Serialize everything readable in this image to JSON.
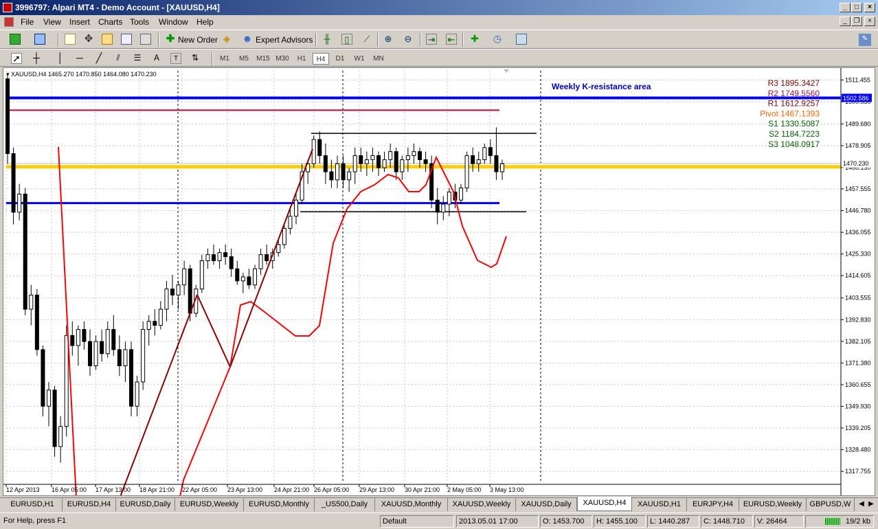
{
  "window": {
    "title": "3996797: Alpari MT4 - Demo Account - [XAUUSD,H4]"
  },
  "menu": [
    "File",
    "View",
    "Insert",
    "Charts",
    "Tools",
    "Window",
    "Help"
  ],
  "toolbar": {
    "new_order": "New Order",
    "expert_advisors": "Expert Advisors"
  },
  "timeframes": [
    "M1",
    "M5",
    "M15",
    "M30",
    "H1",
    "H4",
    "D1",
    "W1",
    "MN"
  ],
  "active_timeframe": "H4",
  "colors": {
    "bull": "#ffffff",
    "bear": "#000000",
    "red_line": "#ff0000",
    "blue_line": "#0000ff",
    "yellow_line": "#ffcc00",
    "crimson": "#cc0033",
    "trend": "#8b0000",
    "pivot_r": "#8b0000",
    "pivot": "#ff6600",
    "pivot_s": "#006400"
  },
  "chart_data": {
    "type": "candlestick",
    "symbol": "XAUUSD,H4",
    "header": "XAUUSD,H4  1465.270 1470.850 1464.080 1470.230",
    "current_price": "1470.230",
    "resistance_label": "1502.586",
    "annotation": "Weekly K-resistance area",
    "ylim": [
      1312,
      1516
    ],
    "yticks": [
      1511.455,
      1500.63,
      1489.68,
      1478.905,
      1468.13,
      1457.555,
      1446.78,
      1436.055,
      1425.33,
      1414.605,
      1403.555,
      1392.83,
      1382.105,
      1371.38,
      1360.655,
      1349.93,
      1339.205,
      1328.48,
      1317.755
    ],
    "xticks": [
      "12 Apr 2013",
      "16 Apr 05:00",
      "17 Apr 13:00",
      "18 Apr 21:00",
      "22 Apr 05:00",
      "23 Apr 13:00",
      "24 Apr 21:00",
      "26 Apr 05:00",
      "29 Apr 13:00",
      "30 Apr 21:00",
      "2 May 05:00",
      "3 May 13:00"
    ],
    "pivots": [
      {
        "label": "R3",
        "value": "1895.3427",
        "kind": "r"
      },
      {
        "label": "R2",
        "value": "1749.5560",
        "kind": "r2"
      },
      {
        "label": "R1",
        "value": "1612.9257",
        "kind": "r"
      },
      {
        "label": "Pivot",
        "value": "1467.1393",
        "kind": "p"
      },
      {
        "label": "S1",
        "value": "1330.5087",
        "kind": "s"
      },
      {
        "label": "S2",
        "value": "1184.7223",
        "kind": "s"
      },
      {
        "label": "S3",
        "value": "1048.0917",
        "kind": "s"
      }
    ],
    "hlines": [
      {
        "value": 1502.586,
        "color": "#0000ff",
        "width": 4,
        "x1": "start",
        "x2": "end"
      },
      {
        "value": 1496.5,
        "color": "#cc0033",
        "width": 2,
        "x1": "start",
        "x2": "722"
      },
      {
        "value": 1468.5,
        "color": "#ffcc00",
        "width": 5,
        "x1": "start",
        "x2": "end"
      },
      {
        "value": 1450.5,
        "color": "#0000ff",
        "width": 3,
        "x1": "start",
        "x2": "722"
      },
      {
        "value": 1485.0,
        "color": "#000000",
        "width": 1.5,
        "x1": "448",
        "x2": "776"
      },
      {
        "value": 1446.2,
        "color": "#000000",
        "width": 1.5,
        "x1": "432",
        "x2": "761"
      }
    ],
    "candles": [
      [
        1512,
        1514,
        1470,
        1475
      ],
      [
        1475,
        1478,
        1440,
        1446
      ],
      [
        1446,
        1460,
        1442,
        1455
      ],
      [
        1455,
        1458,
        1395,
        1398
      ],
      [
        1398,
        1410,
        1390,
        1405
      ],
      [
        1405,
        1408,
        1375,
        1378
      ],
      [
        1378,
        1380,
        1345,
        1350
      ],
      [
        1350,
        1362,
        1340,
        1358
      ],
      [
        1358,
        1360,
        1325,
        1330
      ],
      [
        1330,
        1345,
        1322,
        1340
      ],
      [
        1340,
        1390,
        1335,
        1385
      ],
      [
        1385,
        1392,
        1375,
        1380
      ],
      [
        1380,
        1390,
        1370,
        1388
      ],
      [
        1388,
        1392,
        1378,
        1382
      ],
      [
        1382,
        1388,
        1365,
        1370
      ],
      [
        1370,
        1385,
        1368,
        1382
      ],
      [
        1382,
        1388,
        1372,
        1376
      ],
      [
        1376,
        1392,
        1374,
        1388
      ],
      [
        1388,
        1395,
        1375,
        1378
      ],
      [
        1378,
        1385,
        1365,
        1370
      ],
      [
        1370,
        1382,
        1362,
        1378
      ],
      [
        1378,
        1382,
        1345,
        1350
      ],
      [
        1350,
        1365,
        1345,
        1362
      ],
      [
        1362,
        1392,
        1358,
        1388
      ],
      [
        1388,
        1395,
        1380,
        1392
      ],
      [
        1392,
        1398,
        1385,
        1390
      ],
      [
        1390,
        1402,
        1388,
        1398
      ],
      [
        1398,
        1412,
        1392,
        1408
      ],
      [
        1408,
        1415,
        1400,
        1405
      ],
      [
        1405,
        1412,
        1398,
        1410
      ],
      [
        1410,
        1422,
        1405,
        1418
      ],
      [
        1418,
        1420,
        1392,
        1396
      ],
      [
        1396,
        1410,
        1394,
        1408
      ],
      [
        1408,
        1425,
        1406,
        1422
      ],
      [
        1422,
        1428,
        1418,
        1425
      ],
      [
        1425,
        1430,
        1420,
        1422
      ],
      [
        1422,
        1428,
        1418,
        1426
      ],
      [
        1426,
        1430,
        1420,
        1424
      ],
      [
        1424,
        1428,
        1414,
        1418
      ],
      [
        1418,
        1422,
        1410,
        1412
      ],
      [
        1412,
        1416,
        1406,
        1414
      ],
      [
        1414,
        1418,
        1408,
        1410
      ],
      [
        1410,
        1420,
        1408,
        1418
      ],
      [
        1418,
        1428,
        1415,
        1425
      ],
      [
        1425,
        1430,
        1420,
        1422
      ],
      [
        1422,
        1428,
        1418,
        1426
      ],
      [
        1426,
        1432,
        1424,
        1430
      ],
      [
        1430,
        1440,
        1428,
        1438
      ],
      [
        1438,
        1448,
        1435,
        1444
      ],
      [
        1444,
        1456,
        1440,
        1452
      ],
      [
        1452,
        1470,
        1450,
        1466
      ],
      [
        1466,
        1472,
        1460,
        1470
      ],
      [
        1470,
        1484,
        1468,
        1482
      ],
      [
        1482,
        1486,
        1470,
        1474
      ],
      [
        1474,
        1480,
        1460,
        1466
      ],
      [
        1466,
        1472,
        1458,
        1462
      ],
      [
        1462,
        1474,
        1458,
        1470
      ],
      [
        1470,
        1474,
        1458,
        1462
      ],
      [
        1462,
        1468,
        1456,
        1466
      ],
      [
        1466,
        1478,
        1460,
        1474
      ],
      [
        1474,
        1478,
        1466,
        1470
      ],
      [
        1470,
        1476,
        1464,
        1472
      ],
      [
        1472,
        1478,
        1466,
        1474
      ],
      [
        1474,
        1476,
        1464,
        1468
      ],
      [
        1468,
        1476,
        1466,
        1472
      ],
      [
        1472,
        1480,
        1468,
        1476
      ],
      [
        1476,
        1478,
        1462,
        1466
      ],
      [
        1466,
        1474,
        1462,
        1472
      ],
      [
        1472,
        1478,
        1466,
        1474
      ],
      [
        1474,
        1480,
        1470,
        1476
      ],
      [
        1476,
        1478,
        1468,
        1472
      ],
      [
        1472,
        1476,
        1466,
        1470
      ],
      [
        1470,
        1474,
        1448,
        1452
      ],
      [
        1452,
        1458,
        1440,
        1446
      ],
      [
        1446,
        1454,
        1442,
        1450
      ],
      [
        1450,
        1458,
        1444,
        1456
      ],
      [
        1456,
        1460,
        1448,
        1452
      ],
      [
        1452,
        1460,
        1450,
        1458
      ],
      [
        1458,
        1476,
        1456,
        1474
      ],
      [
        1474,
        1478,
        1466,
        1470
      ],
      [
        1470,
        1476,
        1466,
        1472
      ],
      [
        1472,
        1480,
        1470,
        1478
      ],
      [
        1478,
        1482,
        1470,
        1474
      ],
      [
        1474,
        1488,
        1462,
        1466
      ],
      [
        1466,
        1472,
        1462,
        1470
      ]
    ],
    "red_line": [
      [
        80,
        115
      ],
      [
        110,
        705
      ],
      [
        240,
        705
      ],
      [
        262,
        600
      ],
      [
        330,
        435
      ],
      [
        345,
        345
      ],
      [
        360,
        340
      ],
      [
        380,
        355
      ],
      [
        425,
        390
      ],
      [
        445,
        390
      ],
      [
        460,
        375
      ],
      [
        480,
        255
      ],
      [
        500,
        205
      ],
      [
        520,
        180
      ],
      [
        540,
        170
      ],
      [
        560,
        155
      ],
      [
        575,
        160
      ],
      [
        590,
        180
      ],
      [
        605,
        180
      ],
      [
        615,
        170
      ],
      [
        630,
        130
      ],
      [
        640,
        150
      ],
      [
        655,
        180
      ],
      [
        668,
        230
      ],
      [
        690,
        280
      ],
      [
        710,
        290
      ],
      [
        718,
        285
      ],
      [
        732,
        245
      ]
    ],
    "trend_lines": [
      [
        [
          162,
          645
        ],
        [
          282,
          330
        ]
      ],
      [
        [
          282,
          330
        ],
        [
          330,
          435
        ]
      ],
      [
        [
          330,
          435
        ],
        [
          450,
          118
        ]
      ]
    ]
  },
  "tabs": [
    "EURUSD,H1",
    "EURUSD,H4",
    "EURUSD,Daily",
    "EURUSD,Weekly",
    "EURUSD,Monthly",
    "_US500,Daily",
    "XAUUSD,Monthly",
    "XAUUSD,Weekly",
    "XAUUSD,Daily",
    "XAUUSD,H4",
    "XAUUSD,H1",
    "EURJPY,H4",
    "EURUSD,Weekly",
    "GBPUSD,W"
  ],
  "active_tab": "XAUUSD,H4",
  "status": {
    "help": "For Help, press F1",
    "profile": "Default",
    "datetime": "2013.05.01 17:00",
    "open": "O: 1453.700",
    "high": "H: 1455.100",
    "low": "L: 1440.287",
    "close": "C: 1448.710",
    "volume": "V: 26464",
    "traffic": "19/2 kb"
  }
}
